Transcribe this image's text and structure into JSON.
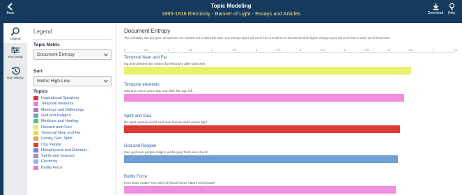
{
  "header": {
    "back_label": "Back",
    "title": "Topic Modeling",
    "subtitle": "1865-1918 Electricity - Banner of Light - Essays and Articles",
    "download_label": "Download",
    "help_label": "Help"
  },
  "rail": {
    "legend_label": "Legend",
    "text_setup_label": "Text Setup",
    "run_history_label": "Run History"
  },
  "legend": {
    "title": "Legend",
    "topic_metric_label": "Topic Metric",
    "topic_metric_value": "Document Entropy",
    "sort_label": "Sort",
    "sort_value": "Metric High-Low",
    "topics_label": "Topics",
    "topics": [
      {
        "label": "Inspirational Speakers",
        "color": "#d8373c"
      },
      {
        "label": "Temporal elements",
        "color": "#f27ed3"
      },
      {
        "label": "Meetings and Gatherings",
        "color": "#b27acb"
      },
      {
        "label": "God and Religion",
        "color": "#6f9fd4"
      },
      {
        "label": "Medicine and Healing",
        "color": "#5bc470"
      },
      {
        "label": "Disease and Cure",
        "color": "#e5e86a"
      },
      {
        "label": "Temporal Near and Far",
        "color": "#f2d447"
      },
      {
        "label": "Family, God, Spirit",
        "color": "#e8a25a"
      },
      {
        "label": "City, People",
        "color": "#d9432d"
      },
      {
        "label": "Metaphysical and Ethereal...",
        "color": "#7a7fd6"
      },
      {
        "label": "Spirits and seances",
        "color": "#a78bd6"
      },
      {
        "label": "Electricity",
        "color": "#8fb7e3"
      },
      {
        "label": "Bodily Force",
        "color": "#ee77d4"
      }
    ]
  },
  "main": {
    "title": "Document Entropy",
    "description": "The probability that any given document in the Content Set is about this topic. Low entropy topics will come from a small set of documents while higher entropy topics will come from a wider set of documents.",
    "axis_ticks": [
      "0",
      "0.5",
      "1",
      "1.5",
      "2",
      "2.5",
      "3",
      "3.5",
      "4",
      "4.5",
      "5",
      "5.5",
      "6",
      "6.5",
      "7",
      "7.5"
    ]
  },
  "chart_data": {
    "type": "bar",
    "orientation": "horizontal",
    "title": "Document Entropy",
    "xlim": [
      0,
      7.5
    ],
    "categories": [
      "Temporal Near and Far",
      "Temporal elements",
      "Spirit and Soul",
      "God and Religion",
      "Bodily Force"
    ],
    "words": [
      "ing time present lion means far electricity able state way",
      "said time came years day man little like ago left",
      "life spirit spiritual world soul man human earth power light",
      "man god men people religion world good truth love church",
      "force body matter form spirit physical forces nature mind power"
    ],
    "values": [
      6.5,
      6.35,
      6.25,
      6.2,
      6.15
    ],
    "colors": [
      "#eaf06a",
      "#f08ee0",
      "#dc3b33",
      "#6f9fd4",
      "#f08ee0"
    ]
  }
}
